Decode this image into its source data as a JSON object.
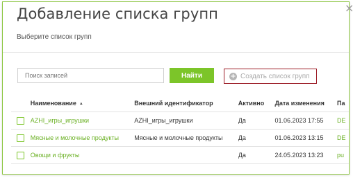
{
  "dialog": {
    "title": "Добавление списка групп",
    "close_glyph": "×",
    "subtitle": "Выберите список групп"
  },
  "toolbar": {
    "search_placeholder": "Поиск записей",
    "find_label": "Найти",
    "create_label": "Создать список групп",
    "create_icon": "plus-circle-icon"
  },
  "table": {
    "headers": {
      "name": "Наименование",
      "external_id": "Внешний идентификатор",
      "active": "Активно",
      "modified": "Дата изменения",
      "extra": "Па"
    },
    "sort": {
      "column": "name",
      "direction": "ascending",
      "glyph": "▲"
    },
    "rows": [
      {
        "name": "AZHI_игры_игрушки",
        "external_id": "AZHI_игры_игрушки",
        "active": "Да",
        "modified": "01.06.2023 17:55",
        "extra": "DE"
      },
      {
        "name": "Мясные и молочные продукты",
        "external_id": "Мясные и молочные продукты",
        "active": "Да",
        "modified": "01.06.2023 13:15",
        "extra": "DE"
      },
      {
        "name": "Овощи и фрукты",
        "external_id": "",
        "active": "Да",
        "modified": "24.05.2023 13:23",
        "extra": "pu"
      }
    ]
  },
  "colors": {
    "accent_green": "#7cc529",
    "link_green": "#6ab023",
    "highlight_border": "#9b1b25"
  }
}
